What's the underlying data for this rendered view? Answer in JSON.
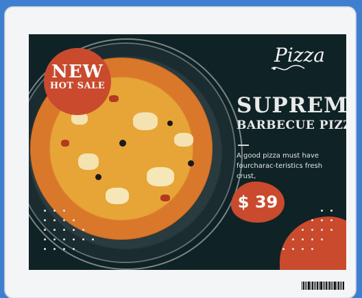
{
  "badge": {
    "line1": "NEW",
    "line2": "HOT SALE"
  },
  "logo": {
    "text": "Pizza",
    "icon": "pizza-logo-icon"
  },
  "title": {
    "line1": "SUPREME",
    "line2": "BARBECUE PIZZA"
  },
  "description": {
    "line1": "A good pizza must have",
    "line2": "fourcharac-teristics  fresh crust,"
  },
  "price": "$ 39",
  "colors": {
    "background": "#0f2326",
    "accent": "#c94a2c",
    "text": "#e9e9e9",
    "frame": "#3f7fd0"
  }
}
